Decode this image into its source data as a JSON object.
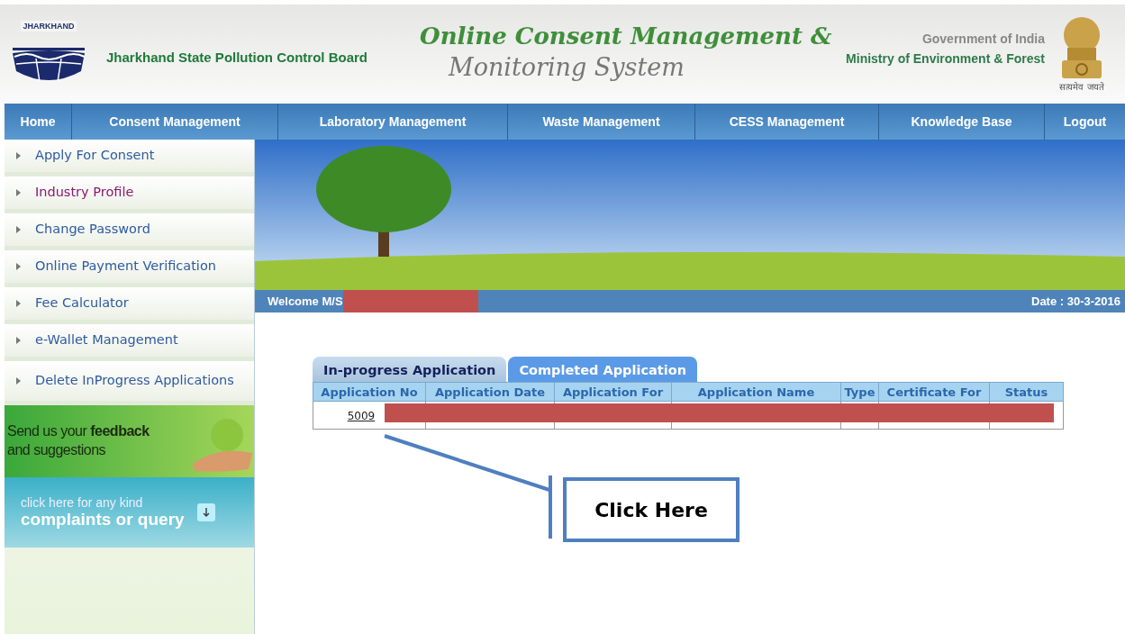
{
  "header": {
    "logo_text": "JHARKHAND",
    "board_name": "Jharkhand State Pollution Control Board",
    "title_line_1": "Online Consent Management &",
    "title_line_2": "Monitoring System",
    "government": "Government of India",
    "ministry": "Ministry of Environment & Forest",
    "motto": "सत्यमेव जयते"
  },
  "nav": [
    {
      "label": "Home"
    },
    {
      "label": "Consent Management"
    },
    {
      "label": "Laboratory Management"
    },
    {
      "label": "Waste Management"
    },
    {
      "label": "CESS Management"
    },
    {
      "label": "Knowledge Base"
    },
    {
      "label": "Logout"
    }
  ],
  "sidebar": {
    "items": [
      {
        "label": "Apply For Consent",
        "visited": false
      },
      {
        "label": "Industry Profile",
        "visited": true
      },
      {
        "label": "Change Password",
        "visited": false
      },
      {
        "label": "Online Payment Verification",
        "visited": false
      },
      {
        "label": "Fee Calculator",
        "visited": false
      },
      {
        "label": "e-Wallet Management",
        "visited": false
      },
      {
        "label": "Delete InProgress Applications",
        "visited": false
      }
    ],
    "feedback": "Send us your **feedback** and suggestions",
    "complaints_small": "click here for any kind",
    "complaints_big": "complaints or query"
  },
  "welcome": {
    "text": "Welcome M/S",
    "date": "Date : 30-3-2016"
  },
  "tabs": [
    {
      "label": "In-progress Application",
      "selected": false
    },
    {
      "label": "Completed Application",
      "selected": true
    }
  ],
  "table": {
    "columns": [
      "Application No",
      "Application Date",
      "Application For",
      "Application Name",
      "Type",
      "Certificate For",
      "Status"
    ],
    "rows": [
      [
        "5009",
        "",
        "",
        "",
        "",
        "",
        ""
      ]
    ]
  },
  "callout": {
    "text": "Click Here"
  }
}
